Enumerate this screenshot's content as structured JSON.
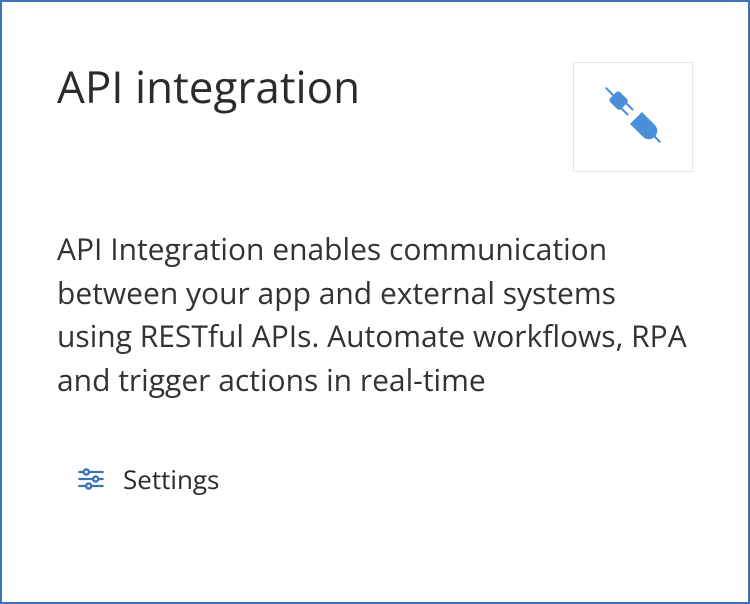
{
  "card": {
    "title": "API integration",
    "description": "API Integration enables communication between your app and external systems using RESTful APIs. Automate workflows, RPA and trigger actions in real-time",
    "icon": "plug-icon",
    "settings_label": "Settings",
    "accent_color": "#4a90d9",
    "border_color": "#3b73b9"
  }
}
